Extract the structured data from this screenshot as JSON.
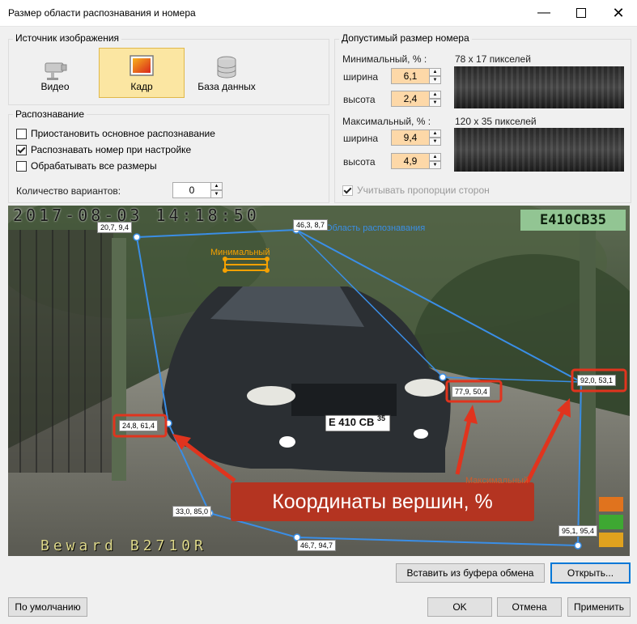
{
  "window": {
    "title": "Размер области распознавания и номера"
  },
  "source": {
    "group_label": "Источник изображения",
    "buttons": [
      {
        "label": "Видео",
        "icon": "camera-icon"
      },
      {
        "label": "Кадр",
        "icon": "frame-icon"
      },
      {
        "label": "База данных",
        "icon": "database-icon"
      }
    ],
    "selected": "Кадр"
  },
  "recognition": {
    "group_label": "Распознавание",
    "options": [
      {
        "label": "Приостановить основное распознавание",
        "checked": false
      },
      {
        "label": "Распознавать номер при настройке",
        "checked": true
      },
      {
        "label": "Обрабатывать все размеры",
        "checked": false
      }
    ],
    "variants_label": "Количество вариантов:",
    "variants_value": "0"
  },
  "plate_size": {
    "group_label": "Допустимый размер номера",
    "min_label": "Минимальный, % :",
    "min_pixels": "78 x 17 пикселей",
    "max_label": "Максимальный, % :",
    "max_pixels": "120 x 35 пикселей",
    "width_label": "ширина",
    "height_label": "высота",
    "min_width": "6,1",
    "min_height": "2,4",
    "max_width": "9,4",
    "max_height": "4,9",
    "keep_ratio_label": "Учитывать пропорции сторон",
    "keep_ratio_checked": true
  },
  "frame": {
    "timestamp": "2017-08-03 14:18:50",
    "camera_caption": "Beward B2710R",
    "plate_result": "E410CB35",
    "area_label": "Область распознавания",
    "min_label": "Минимальный",
    "max_label": "Максимальный",
    "car_plate": "E 410 CB",
    "car_plate_region": "35",
    "callout": "Координаты вершин, %",
    "vertices": [
      "20,7, 9,4",
      "46,3, 8,7",
      "92,0, 53,1",
      "77,9, 50,4",
      "24,8, 61,4",
      "33,0, 85,0",
      "46,7, 94,7",
      "95,1, 95,4"
    ]
  },
  "buttons": {
    "paste": "Вставить из буфера обмена",
    "open": "Открыть...",
    "defaults": "По умолчанию",
    "ok": "OK",
    "cancel": "Отмена",
    "apply": "Применить"
  },
  "colors": {
    "accent_orange": "#f5a100",
    "selected_bg": "#fbe6a2",
    "value_bg": "#fdd8a8",
    "area_blue": "#3a8ee6",
    "callout_red": "#e0341e"
  }
}
